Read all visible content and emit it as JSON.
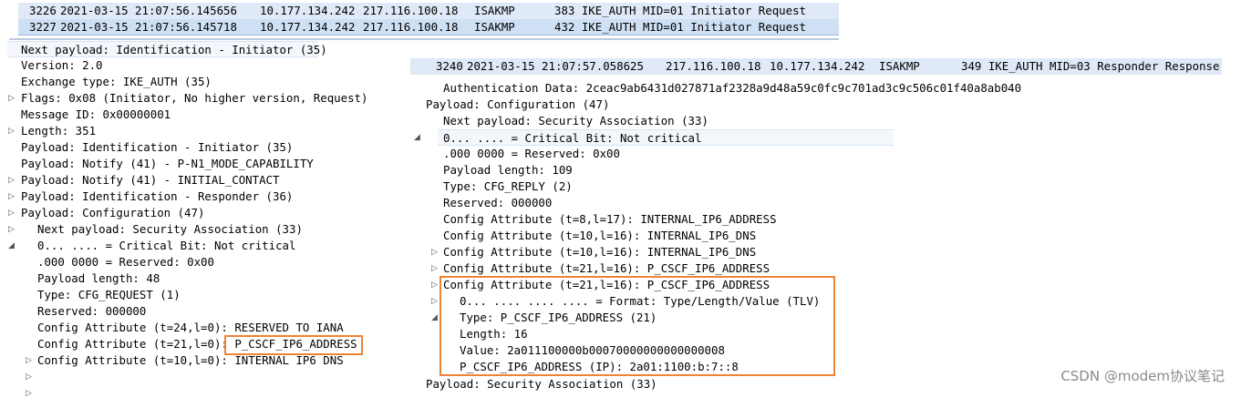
{
  "left_packets": [
    {
      "no": "3226",
      "time": "2021-03-15 21:07:56.145656",
      "src": "10.177.134.242",
      "dst": "217.116.100.18",
      "proto": "ISAKMP",
      "info": "383 IKE_AUTH MID=01 Initiator Request"
    },
    {
      "no": "3227",
      "time": "2021-03-15 21:07:56.145718",
      "src": "10.177.134.242",
      "dst": "217.116.100.18",
      "proto": "ISAKMP",
      "info": "432 IKE_AUTH MID=01 Initiator Request"
    }
  ],
  "left_tree": [
    {
      "text": "Next payload: Identification - Initiator (35)",
      "toggle": ""
    },
    {
      "text": "Version: 2.0",
      "toggle": "▷"
    },
    {
      "text": "Exchange type: IKE_AUTH (35)",
      "toggle": ""
    },
    {
      "text": "Flags: 0x08 (Initiator, No higher version, Request)",
      "toggle": "▷"
    },
    {
      "text": "Message ID: 0x00000001",
      "toggle": ""
    },
    {
      "text": "Length: 351",
      "toggle": ""
    },
    {
      "text": "Payload: Identification - Initiator (35)",
      "toggle": "▷"
    },
    {
      "text": "Payload: Notify (41) - P-N1_MODE_CAPABILITY",
      "toggle": "▷"
    },
    {
      "text": "Payload: Notify (41) - INITIAL_CONTACT",
      "toggle": "▷"
    },
    {
      "text": "Payload: Identification - Responder (36)",
      "toggle": "▷"
    },
    {
      "text": "Payload: Configuration (47)",
      "toggle": "◢"
    },
    {
      "text": "Next payload: Security Association (33)",
      "toggle": ""
    },
    {
      "text": "0... .... = Critical Bit: Not critical",
      "toggle": ""
    },
    {
      "text": ".000 0000 = Reserved: 0x00",
      "toggle": ""
    },
    {
      "text": "Payload length: 48",
      "toggle": ""
    },
    {
      "text": "Type: CFG_REQUEST (1)",
      "toggle": ""
    },
    {
      "text": "Reserved: 000000",
      "toggle": ""
    },
    {
      "text": "Config Attribute (t=24,l=0): RESERVED TO IANA",
      "toggle": "▷"
    },
    {
      "text": "Config Attribute (t=21,l=0): P_CSCF_IP6_ADDRESS",
      "toggle": "▷"
    },
    {
      "text": "Config Attribute (t=10,l=0): INTERNAL IP6 DNS",
      "toggle": "▷"
    }
  ],
  "right_packet": {
    "no": "3240",
    "time": "2021-03-15 21:07:57.058625",
    "src": "217.116.100.18",
    "dst": "10.177.134.242",
    "proto": "ISAKMP",
    "info": "349 IKE_AUTH MID=03 Responder Response"
  },
  "right_tree": [
    {
      "text": "Authentication Data: 2ceac9ab6431d027871af2328a9d48a59c0fc9c701ad3c9c506c01f40a8ab040",
      "toggle": ""
    },
    {
      "text": "Payload: Configuration (47)",
      "toggle": "◢"
    },
    {
      "text": "Next payload: Security Association (33)",
      "toggle": ""
    },
    {
      "text": "0... .... = Critical Bit: Not critical",
      "toggle": ""
    },
    {
      "text": ".000 0000 = Reserved: 0x00",
      "toggle": ""
    },
    {
      "text": "Payload length: 109",
      "toggle": ""
    },
    {
      "text": "Type: CFG_REPLY (2)",
      "toggle": ""
    },
    {
      "text": "Reserved: 000000",
      "toggle": ""
    },
    {
      "text": "Config Attribute (t=8,l=17): INTERNAL_IP6_ADDRESS",
      "toggle": "▷"
    },
    {
      "text": "Config Attribute (t=10,l=16): INTERNAL_IP6_DNS",
      "toggle": "▷"
    },
    {
      "text": "Config Attribute (t=10,l=16): INTERNAL_IP6_DNS",
      "toggle": "▷"
    },
    {
      "text": "Config Attribute (t=21,l=16): P_CSCF_IP6_ADDRESS",
      "toggle": "▷"
    },
    {
      "text": "Config Attribute (t=21,l=16): P_CSCF_IP6_ADDRESS",
      "toggle": "◢"
    },
    {
      "text": "0... .... .... .... = Format: Type/Length/Value (TLV)",
      "toggle": ""
    },
    {
      "text": "Type: P_CSCF_IP6_ADDRESS (21)",
      "toggle": ""
    },
    {
      "text": "Length: 16",
      "toggle": ""
    },
    {
      "text": "Value: 2a011100000b00070000000000000008",
      "toggle": ""
    },
    {
      "text": "P_CSCF_IP6_ADDRESS (IP): 2a01:1100:b:7::8",
      "toggle": ""
    },
    {
      "text": "Payload: Security Association (33)",
      "toggle": "▷"
    }
  ],
  "watermark": "CSDN @modem协议笔记",
  "colors": {
    "highlight_box": "#ef8335",
    "packet_row_bg": "#dfe9f7",
    "selected_row_bg": "#cfe0f5"
  }
}
